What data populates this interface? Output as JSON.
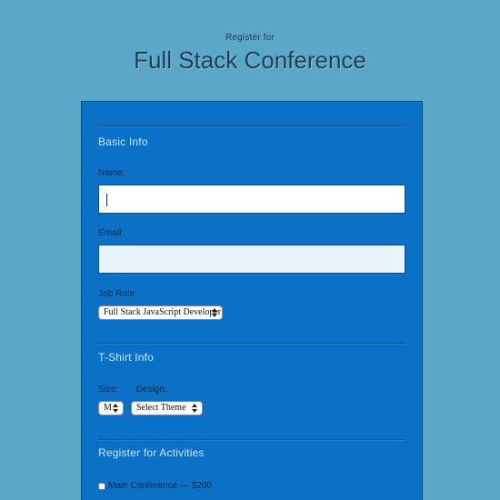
{
  "header": {
    "subtitle": "Register for",
    "title": "Full Stack Conference"
  },
  "sections": {
    "basic_info": "Basic Info",
    "tshirt_info": "T-Shirt Info",
    "activities": "Register for Activities"
  },
  "fields": {
    "name_label": "Name:",
    "name_value": "",
    "email_label": "Email:",
    "email_value": "",
    "job_role_label": "Job Role",
    "job_role_selected": "Full Stack JavaScript Developer"
  },
  "tshirt": {
    "size_label": "Size:",
    "design_label": "Design:",
    "size_selected": "M",
    "design_selected": "Select Theme"
  },
  "activities": {
    "items": [
      {
        "label": "Main Conference — $200",
        "checked": false
      }
    ]
  },
  "colors": {
    "background": "#5ba7c8",
    "panel": "#0a71c6",
    "title_text": "#1f3f56",
    "section_text": "#d6ecff",
    "label_text": "#0b2740",
    "email_bg": "#e6f3fb"
  },
  "icons": {
    "select_arrows": "updown-arrows-icon"
  }
}
